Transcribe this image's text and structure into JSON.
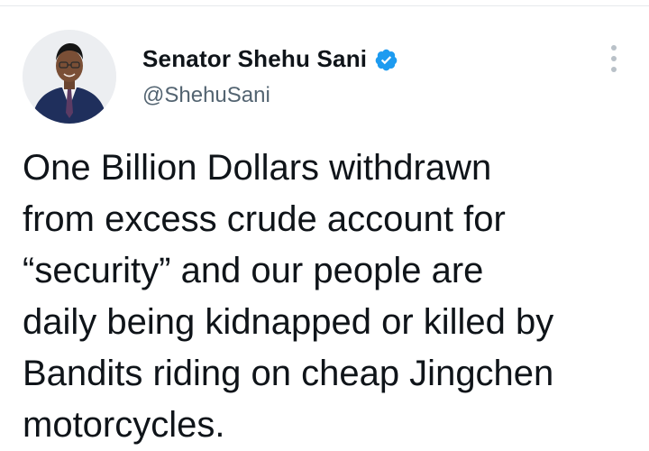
{
  "author": {
    "display_name": "Senator Shehu Sani",
    "handle": "@ShehuSani",
    "verified": true,
    "verified_badge_color": "#1d9bf0",
    "avatar_icon": "avatar",
    "verified_icon": "verified-badge-icon"
  },
  "menu": {
    "icon": "more-options-icon"
  },
  "tweet": {
    "lines": [
      "One Billion Dollars withdrawn",
      "from excess crude account for",
      "“security” and our people are",
      "daily being kidnapped or killed by",
      "Bandits riding on cheap Jingchen",
      "motorcycles."
    ]
  }
}
